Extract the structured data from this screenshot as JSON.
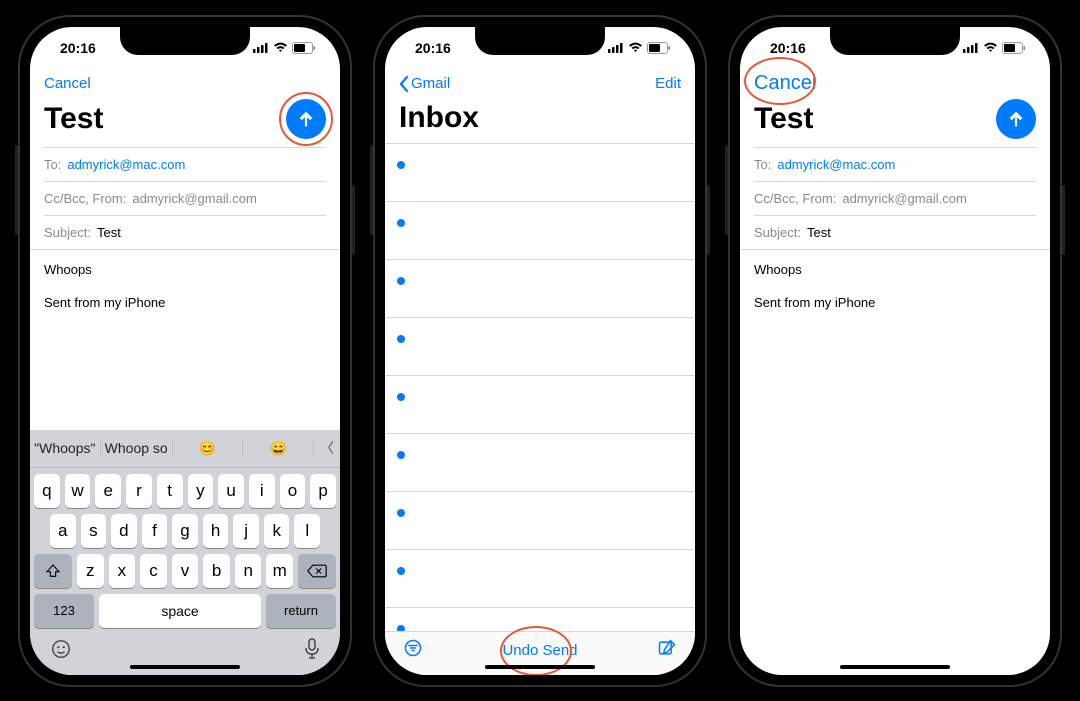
{
  "status": {
    "time": "20:16",
    "signal_icon": "signal-icon",
    "wifi_icon": "wifi-icon",
    "battery_icon": "battery-icon"
  },
  "phone1": {
    "cancel": "Cancel",
    "title": "Test",
    "send_icon": "arrow-up-icon",
    "fields": {
      "to_label": "To:",
      "to_value": "admyrick@mac.com",
      "ccbcc_label": "Cc/Bcc, From:",
      "ccbcc_value": "admyrick@gmail.com",
      "subject_label": "Subject:",
      "subject_value": "Test"
    },
    "body": {
      "line1": "Whoops",
      "line2": "Sent from my iPhone"
    },
    "predictions": {
      "p1": "\"Whoops\"",
      "p2": "Whoop so",
      "p3": "😊",
      "p4": "😄"
    },
    "keys_r1": [
      "q",
      "w",
      "e",
      "r",
      "t",
      "y",
      "u",
      "i",
      "o",
      "p"
    ],
    "keys_r2": [
      "a",
      "s",
      "d",
      "f",
      "g",
      "h",
      "j",
      "k",
      "l"
    ],
    "keys_r3": [
      "z",
      "x",
      "c",
      "v",
      "b",
      "n",
      "m"
    ],
    "keys_bottom": {
      "num": "123",
      "space": "space",
      "return": "return"
    }
  },
  "phone2": {
    "back": "Gmail",
    "edit": "Edit",
    "title": "Inbox",
    "undo": "Undo Send",
    "filter_icon": "filter-icon",
    "compose_icon": "compose-icon"
  },
  "phone3": {
    "cancel": "Cancel",
    "title": "Test",
    "send_icon": "arrow-up-icon",
    "fields": {
      "to_label": "To:",
      "to_value": "admyrick@mac.com",
      "ccbcc_label": "Cc/Bcc, From:",
      "ccbcc_value": "admyrick@gmail.com",
      "subject_label": "Subject:",
      "subject_value": "Test"
    },
    "body": {
      "line1": "Whoops",
      "line2": "Sent from my iPhone"
    }
  }
}
